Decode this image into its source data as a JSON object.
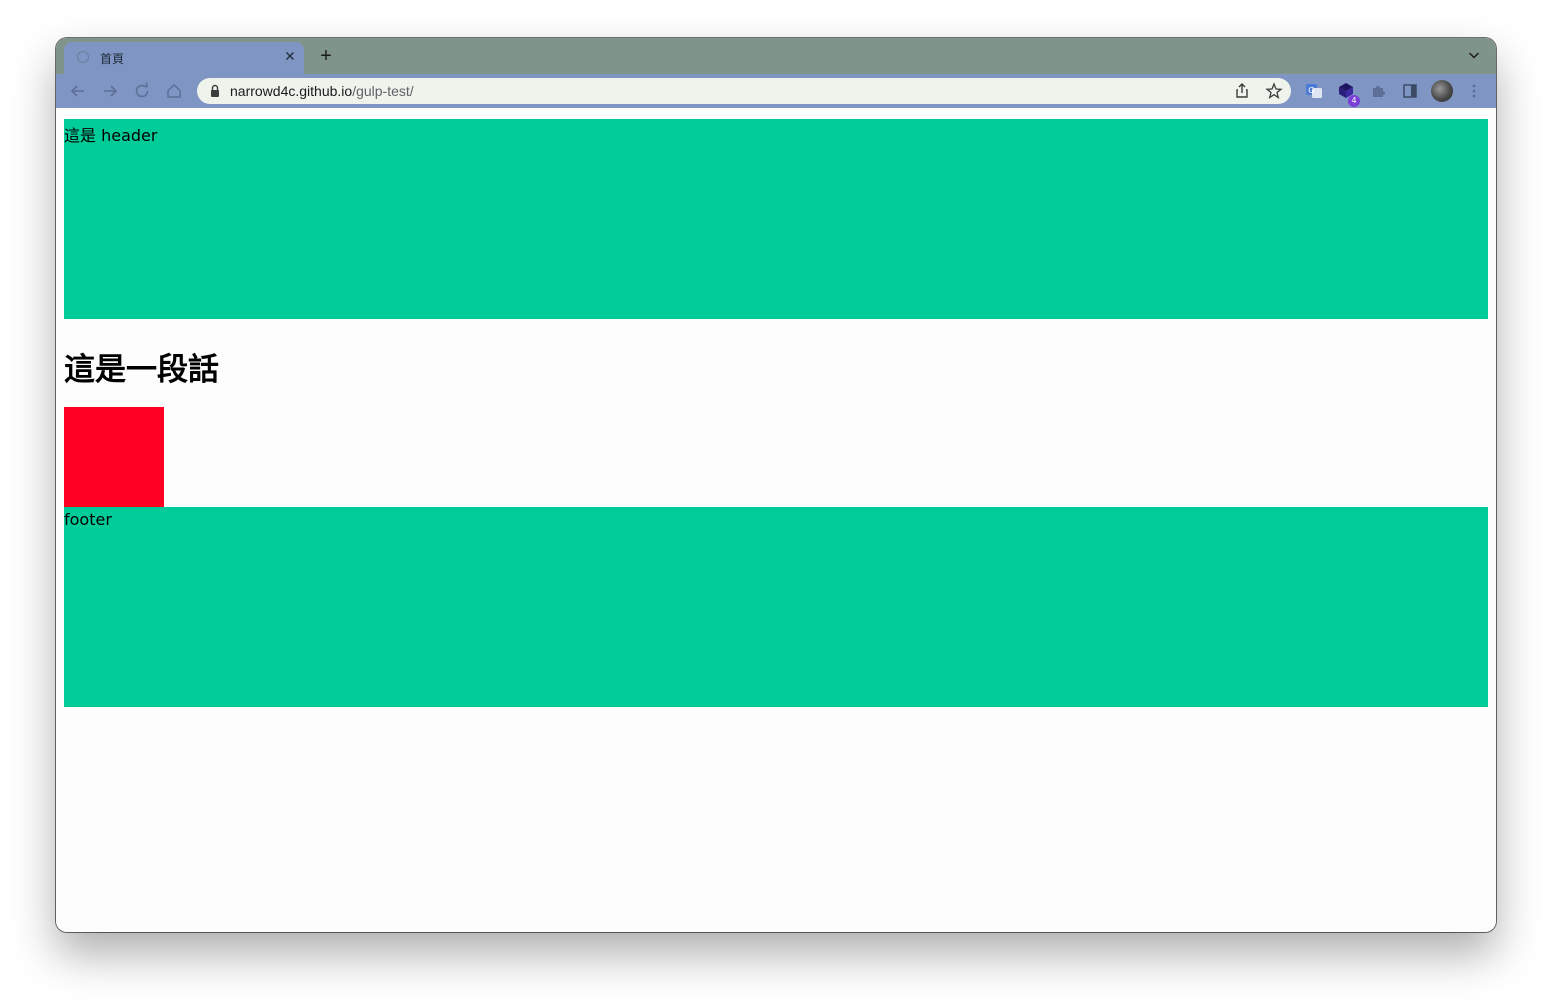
{
  "browser": {
    "tab": {
      "title": "首頁",
      "close_icon": "close-icon",
      "favicon": "globe-icon"
    },
    "new_tab_label": "+",
    "url_host": "narrowd4c.github.io",
    "url_path": "/gulp-test/",
    "extension_badge_count": "4",
    "colors": {
      "tabstrip": "#7f958a",
      "toolbar": "#7f96c4",
      "omnibox": "#eef3ec"
    }
  },
  "page": {
    "header_text": "這是 header",
    "heading": "這是一段話",
    "footer_text": "footer",
    "colors": {
      "header": "#00cc99",
      "box": "#ff0022",
      "footer": "#00cc99"
    }
  }
}
